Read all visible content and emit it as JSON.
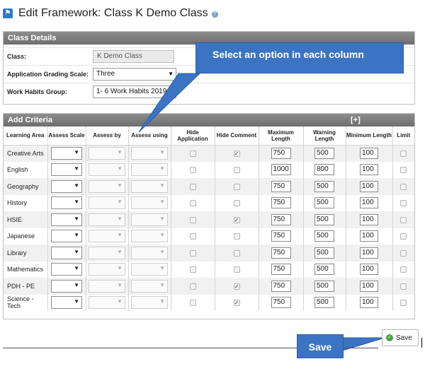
{
  "page": {
    "title": "Edit Framework: Class K Demo Class",
    "framework_icon": "framework-icon",
    "help_icon": "help-icon"
  },
  "class_details": {
    "heading": "Class Details",
    "class_label": "Class:",
    "class_value": "K Demo Class",
    "grading_label": "Application Grading Scale:",
    "grading_value": "Three",
    "habits_label": "Work Habits Group:",
    "habits_value": "1- 6 Work Habits 2019"
  },
  "criteria": {
    "heading": "Add Criteria",
    "add_link": "[+]",
    "headers": [
      "Learning Area",
      "Assess Scale",
      "Assess by",
      "Assess using",
      "Hide Application",
      "Hide Comment",
      "Maximum Length",
      "Warning Length",
      "Minimum Length",
      "Limit"
    ],
    "rows": [
      {
        "area": "Creative Arts",
        "hide_app": false,
        "hide_comment": true,
        "max": "750",
        "warn": "500",
        "min": "100"
      },
      {
        "area": "English",
        "hide_app": false,
        "hide_comment": false,
        "max": "1000",
        "warn": "800",
        "min": "100"
      },
      {
        "area": "Geography",
        "hide_app": false,
        "hide_comment": false,
        "max": "750",
        "warn": "500",
        "min": "100"
      },
      {
        "area": "History",
        "hide_app": false,
        "hide_comment": false,
        "max": "750",
        "warn": "500",
        "min": "100"
      },
      {
        "area": "HSIE",
        "hide_app": false,
        "hide_comment": true,
        "max": "750",
        "warn": "500",
        "min": "100"
      },
      {
        "area": "Japanese",
        "hide_app": false,
        "hide_comment": false,
        "max": "750",
        "warn": "500",
        "min": "100"
      },
      {
        "area": "Library",
        "hide_app": false,
        "hide_comment": false,
        "max": "750",
        "warn": "500",
        "min": "100"
      },
      {
        "area": "Mathematics",
        "hide_app": false,
        "hide_comment": false,
        "max": "750",
        "warn": "500",
        "min": "100"
      },
      {
        "area": "PDH - PE",
        "hide_app": false,
        "hide_comment": true,
        "max": "750",
        "warn": "500",
        "min": "100"
      },
      {
        "area": "Science - Tech",
        "hide_app": false,
        "hide_comment": true,
        "max": "750",
        "warn": "500",
        "min": "100"
      }
    ]
  },
  "annotations": {
    "column_callout": "Select an option in each column",
    "save_callout": "Save"
  },
  "actions": {
    "save_label": "Save"
  },
  "colors": {
    "callout": "#3b74c3",
    "header_bar": "#7a7a7a"
  }
}
